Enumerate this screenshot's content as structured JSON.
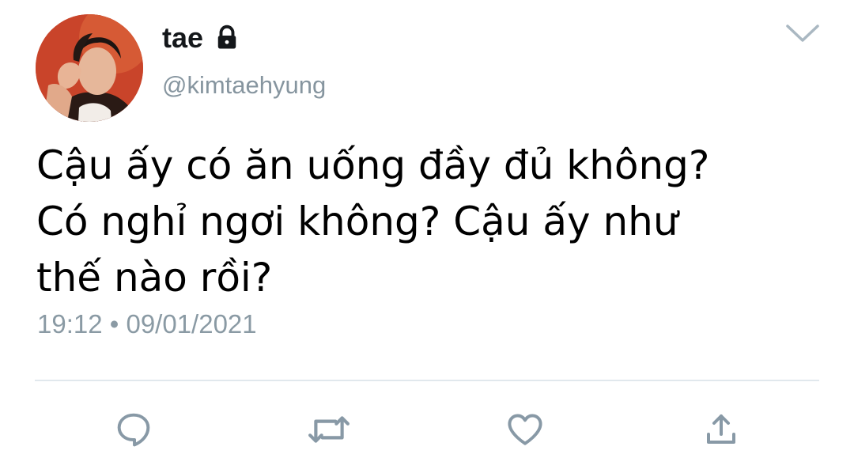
{
  "author": {
    "display_name": "tae",
    "handle": "@kimtaehyung",
    "verified_icon": "lock-icon"
  },
  "tweet": {
    "text": "Cậu ấy có ăn uống đầy đủ không?\nCó nghỉ ngơi không? Cậu ấy như\nthế nào rồi?",
    "timestamp": "19:12 • 09/01/2021"
  },
  "actions": [
    {
      "icon": "reply-icon"
    },
    {
      "icon": "retweet-icon"
    },
    {
      "icon": "like-icon"
    },
    {
      "icon": "share-icon"
    }
  ],
  "colors": {
    "text": "#000000",
    "secondary": "#86959f",
    "icon": "#8899a6",
    "divider": "#e1e8ed",
    "avatar_bg": "#c9442a"
  }
}
